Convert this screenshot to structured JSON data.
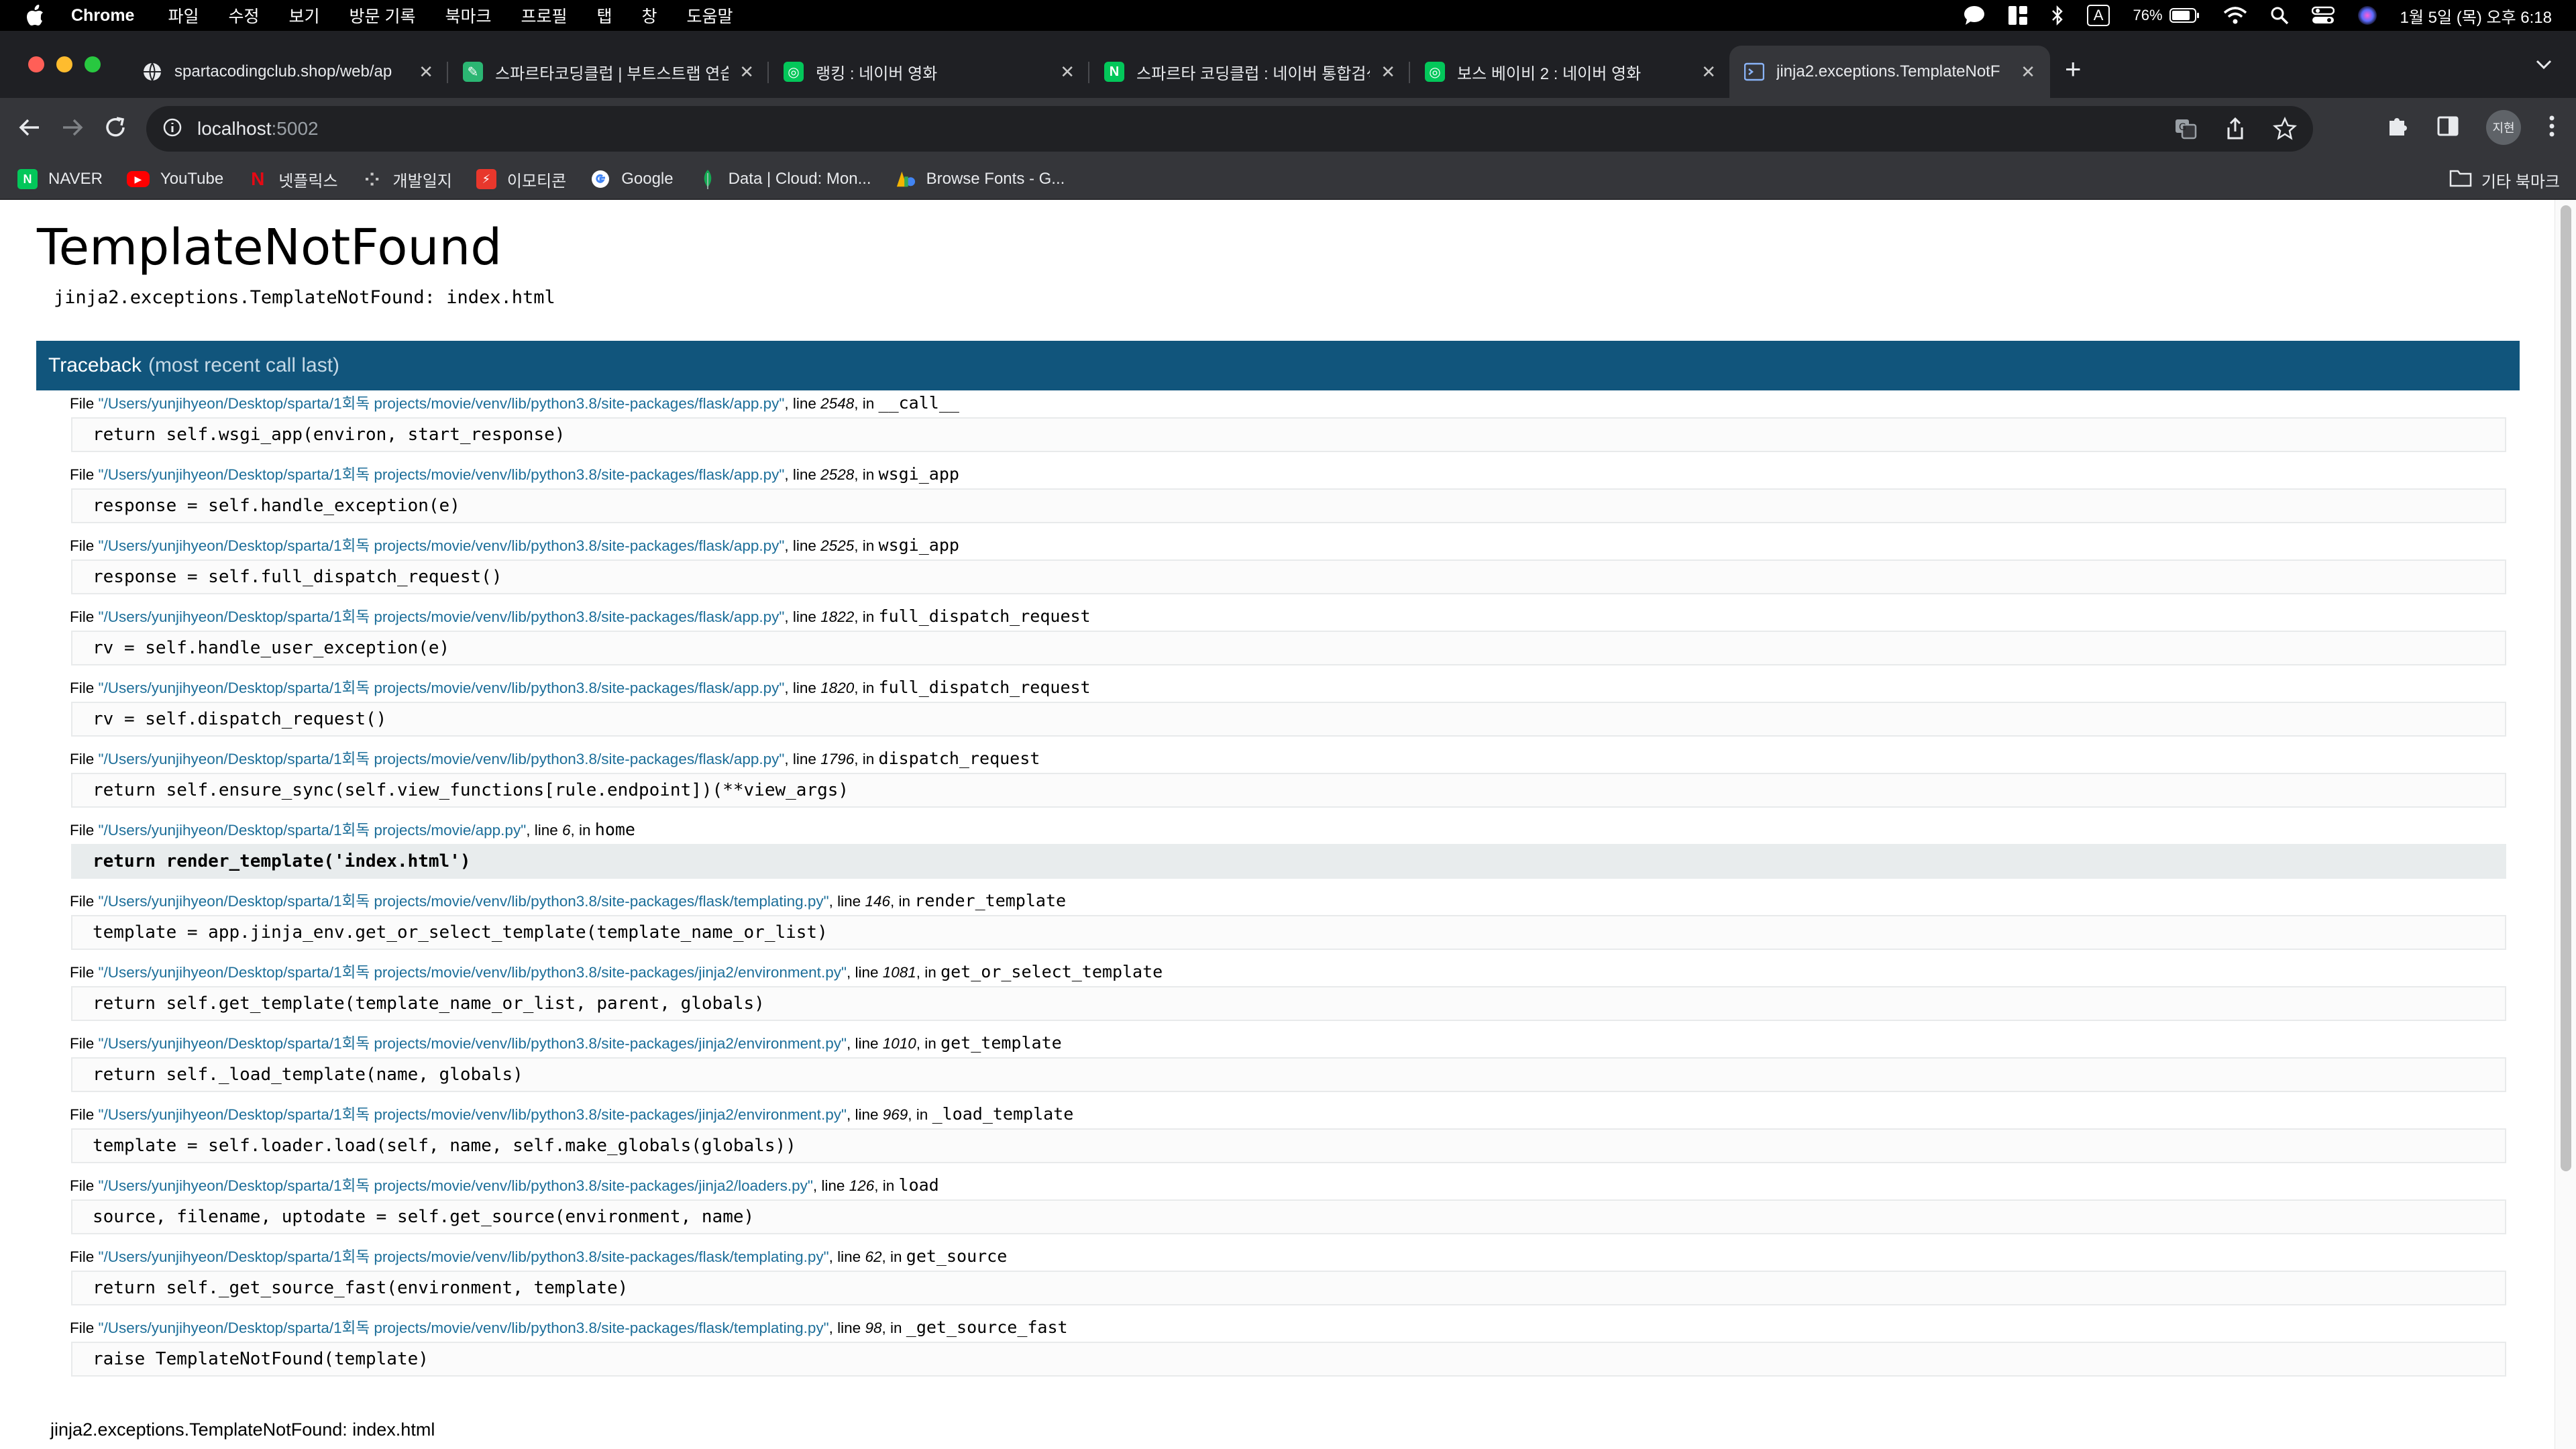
{
  "menubar": {
    "app": "Chrome",
    "items": [
      "파일",
      "수정",
      "보기",
      "방문 기록",
      "북마크",
      "프로필",
      "탭",
      "창",
      "도움말"
    ],
    "battery": "76%",
    "input_indicator": "A",
    "datetime": "1월 5일 (목) 오후 6:18"
  },
  "tabs": [
    {
      "title": "spartacodingclub.shop/web/ap",
      "favicon": "globe-icon",
      "color": "#3c4043"
    },
    {
      "title": "스파르타코딩클럽 | 부트스트랩 연습",
      "favicon": "spartacoding-icon",
      "color": "#2bb673"
    },
    {
      "title": "랭킹 : 네이버 영화",
      "favicon": "naver-movie-icon",
      "color": "#03c75a"
    },
    {
      "title": "스파르타 코딩클럽 : 네이버 통합검색",
      "favicon": "naver-icon",
      "color": "#03c75a"
    },
    {
      "title": "보스 베이비 2 : 네이버 영화",
      "favicon": "naver-movie-icon",
      "color": "#03c75a"
    },
    {
      "title": "jinja2.exceptions.TemplateNotF",
      "favicon": "terminal-icon",
      "color": "#8ab4f8"
    }
  ],
  "toolbar": {
    "url_host": "localhost",
    "url_port": ":5002",
    "profile": "지현"
  },
  "bookmarks": [
    {
      "label": "NAVER",
      "icon": "N",
      "color": "#03c75a"
    },
    {
      "label": "YouTube",
      "icon": "▶",
      "color": "#ff0000"
    },
    {
      "label": "넷플릭스",
      "icon": "N",
      "color": "#e50914"
    },
    {
      "label": "개발일지",
      "icon": "·",
      "color": "#35363a"
    },
    {
      "label": "이모티콘",
      "icon": "⚡",
      "color": "#e8372c"
    },
    {
      "label": "Google",
      "icon": "G",
      "color": "#ffffff"
    },
    {
      "label": "Data | Cloud: Mon...",
      "icon": "◆",
      "color": "#13aa52"
    },
    {
      "label": "Browse Fonts - G...",
      "icon": "A",
      "color": "#f4b400"
    }
  ],
  "bookmarks_other": "기타 북마크",
  "error": {
    "title": "TemplateNotFound",
    "message": "jinja2.exceptions.TemplateNotFound: index.html",
    "traceback_label": "Traceback",
    "traceback_sub": "(most recent call last)",
    "footer": "jinja2.exceptions.TemplateNotFound: index.html"
  },
  "frames": [
    {
      "file": "\"/Users/yunjihyeon/Desktop/sparta/1회독 projects/movie/venv/lib/python3.8/site-packages/flask/app.py\"",
      "line": "2548",
      "func": "__call__",
      "code": "return self.wsgi_app(environ, start_response)",
      "current": false
    },
    {
      "file": "\"/Users/yunjihyeon/Desktop/sparta/1회독 projects/movie/venv/lib/python3.8/site-packages/flask/app.py\"",
      "line": "2528",
      "func": "wsgi_app",
      "code": "response = self.handle_exception(e)",
      "current": false
    },
    {
      "file": "\"/Users/yunjihyeon/Desktop/sparta/1회독 projects/movie/venv/lib/python3.8/site-packages/flask/app.py\"",
      "line": "2525",
      "func": "wsgi_app",
      "code": "response = self.full_dispatch_request()",
      "current": false
    },
    {
      "file": "\"/Users/yunjihyeon/Desktop/sparta/1회독 projects/movie/venv/lib/python3.8/site-packages/flask/app.py\"",
      "line": "1822",
      "func": "full_dispatch_request",
      "code": "rv = self.handle_user_exception(e)",
      "current": false
    },
    {
      "file": "\"/Users/yunjihyeon/Desktop/sparta/1회독 projects/movie/venv/lib/python3.8/site-packages/flask/app.py\"",
      "line": "1820",
      "func": "full_dispatch_request",
      "code": "rv = self.dispatch_request()",
      "current": false
    },
    {
      "file": "\"/Users/yunjihyeon/Desktop/sparta/1회독 projects/movie/venv/lib/python3.8/site-packages/flask/app.py\"",
      "line": "1796",
      "func": "dispatch_request",
      "code": "return self.ensure_sync(self.view_functions[rule.endpoint])(**view_args)",
      "current": false
    },
    {
      "file": "\"/Users/yunjihyeon/Desktop/sparta/1회독 projects/movie/app.py\"",
      "line": "6",
      "func": "home",
      "code": "return render_template('index.html')",
      "current": true
    },
    {
      "file": "\"/Users/yunjihyeon/Desktop/sparta/1회독 projects/movie/venv/lib/python3.8/site-packages/flask/templating.py\"",
      "line": "146",
      "func": "render_template",
      "code": "template = app.jinja_env.get_or_select_template(template_name_or_list)",
      "current": false
    },
    {
      "file": "\"/Users/yunjihyeon/Desktop/sparta/1회독 projects/movie/venv/lib/python3.8/site-packages/jinja2/environment.py\"",
      "line": "1081",
      "func": "get_or_select_template",
      "code": "return self.get_template(template_name_or_list, parent, globals)",
      "current": false
    },
    {
      "file": "\"/Users/yunjihyeon/Desktop/sparta/1회독 projects/movie/venv/lib/python3.8/site-packages/jinja2/environment.py\"",
      "line": "1010",
      "func": "get_template",
      "code": "return self._load_template(name, globals)",
      "current": false
    },
    {
      "file": "\"/Users/yunjihyeon/Desktop/sparta/1회독 projects/movie/venv/lib/python3.8/site-packages/jinja2/environment.py\"",
      "line": "969",
      "func": "_load_template",
      "code": "template = self.loader.load(self, name, self.make_globals(globals))",
      "current": false
    },
    {
      "file": "\"/Users/yunjihyeon/Desktop/sparta/1회독 projects/movie/venv/lib/python3.8/site-packages/jinja2/loaders.py\"",
      "line": "126",
      "func": "load",
      "code": "source, filename, uptodate = self.get_source(environment, name)",
      "current": false
    },
    {
      "file": "\"/Users/yunjihyeon/Desktop/sparta/1회독 projects/movie/venv/lib/python3.8/site-packages/flask/templating.py\"",
      "line": "62",
      "func": "get_source",
      "code": "return self._get_source_fast(environment, template)",
      "current": false
    },
    {
      "file": "\"/Users/yunjihyeon/Desktop/sparta/1회독 projects/movie/venv/lib/python3.8/site-packages/flask/templating.py\"",
      "line": "98",
      "func": "_get_source_fast",
      "code": "raise TemplateNotFound(template)",
      "current": false
    }
  ],
  "labels": {
    "file_prefix": "File ",
    "line_prefix": ", line ",
    "in_prefix": ", in "
  }
}
